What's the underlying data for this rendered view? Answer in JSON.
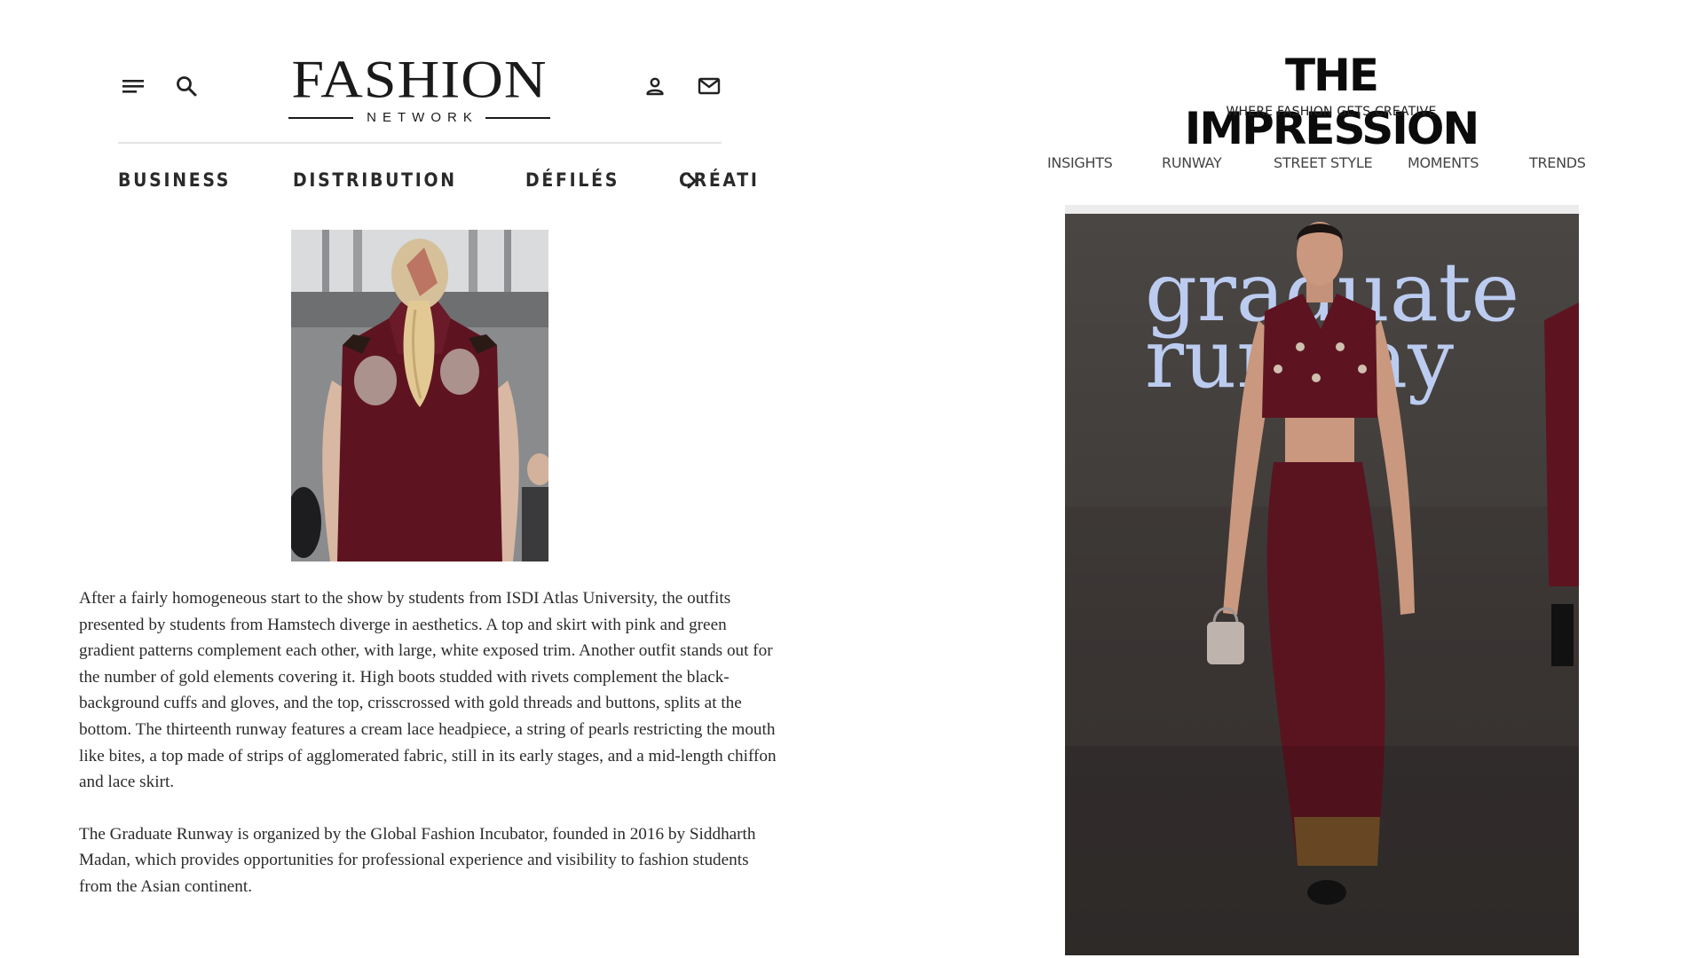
{
  "left": {
    "header": {
      "logo_main": "FASHION",
      "logo_sub": "NETWORK",
      "icons": [
        "menu-icon",
        "search-icon",
        "account-icon",
        "mail-icon"
      ]
    },
    "nav": {
      "items": [
        "BUSINESS",
        "DISTRIBUTION",
        "DÉFILÉS",
        "CRÉATI"
      ],
      "more_icon": "chevron-right-icon"
    },
    "article": {
      "paragraphs": [
        "After a fairly homogeneous start to the show by students from ISDI Atlas University, the outfits presented by students from Hamstech diverge in aesthetics. A top and skirt with pink and green gradient patterns complement each other, with large, white exposed trim. Another outfit stands out for the number of gold elements covering it. High boots studded with rivets complement the black-background cuffs and gloves, and the top, crisscrossed with gold threads and buttons, splits at the bottom. The thirteenth runway features a cream lace headpiece, a string of pearls restricting the mouth like bites, a top made of strips of agglomerated fabric, still in its early stages, and a mid-length chiffon and lace skirt.",
        "The Graduate Runway is organized by the Global Fashion Incubator, founded in 2016 by Siddharth Madan, which provides opportunities for professional experience and visibility to fashion students from the Asian continent."
      ]
    }
  },
  "right": {
    "logo": "THE IMPRESSION",
    "tagline": "WHERE FASHION GETS CREATIVE",
    "nav": {
      "items": [
        "INSIGHTS",
        "RUNWAY",
        "STREET STYLE",
        "MOMENTS",
        "TRENDS"
      ]
    },
    "photo": {
      "backdrop_text_line1": "graduate",
      "backdrop_text_line2": "runway"
    }
  },
  "colors": {
    "burgundy": "#5e1420",
    "text_dark": "#222222",
    "divider": "#e3e3e3",
    "stage_floor": "#3b3633",
    "backdrop_text": "#c6d8ff"
  }
}
